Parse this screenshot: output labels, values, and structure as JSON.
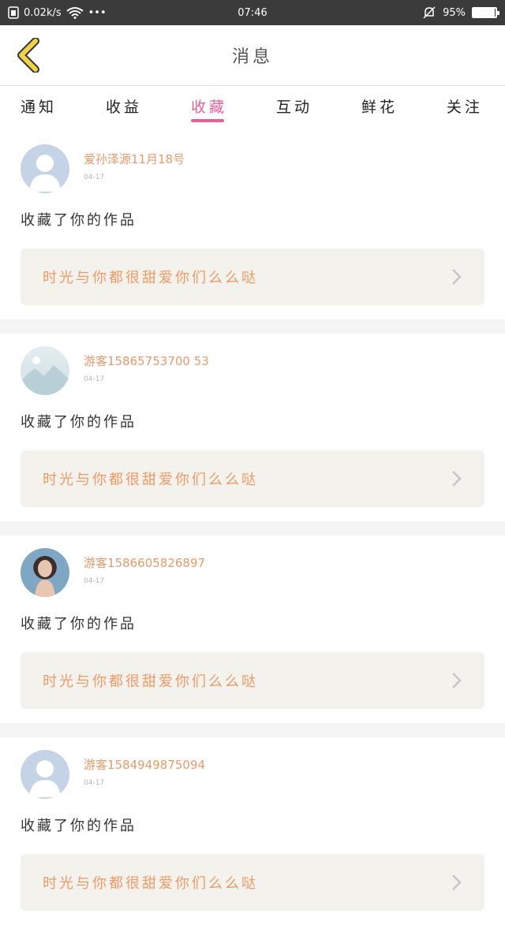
{
  "status_bar": {
    "speed": "0.02k/s",
    "dots": "•••",
    "time": "07:46",
    "battery": "95%",
    "battery_level": 0.95
  },
  "header": {
    "title": "消息"
  },
  "tabs": [
    {
      "label": "通知",
      "active": false
    },
    {
      "label": "收益",
      "active": false
    },
    {
      "label": "收藏",
      "active": true
    },
    {
      "label": "互动",
      "active": false
    },
    {
      "label": "鲜花",
      "active": false
    },
    {
      "label": "关注",
      "active": false
    }
  ],
  "items": [
    {
      "avatar": "default-avatar-icon",
      "name": "爱孙泽源11月18号",
      "date": "04-17",
      "action": "收藏了你的作品",
      "work": "时光与你都很甜爱你们么么哒"
    },
    {
      "avatar": "landscape-avatar-icon",
      "name": "游客15865753700 53",
      "date": "04-17",
      "action": "收藏了你的作品",
      "work": "时光与你都很甜爱你们么么哒"
    },
    {
      "avatar": "photo-avatar",
      "name": "游客1586605826897",
      "date": "04-17",
      "action": "收藏了你的作品",
      "work": "时光与你都很甜爱你们么么哒"
    },
    {
      "avatar": "default-avatar-icon",
      "name": "游客1584949875094",
      "date": "04-17",
      "action": "收藏了你的作品",
      "work": "时光与你都很甜爱你们么么哒"
    }
  ],
  "colors": {
    "accent": "#e8609a",
    "name": "#e89a6a",
    "work": "#ee9a66",
    "back": "#f0d24a"
  }
}
